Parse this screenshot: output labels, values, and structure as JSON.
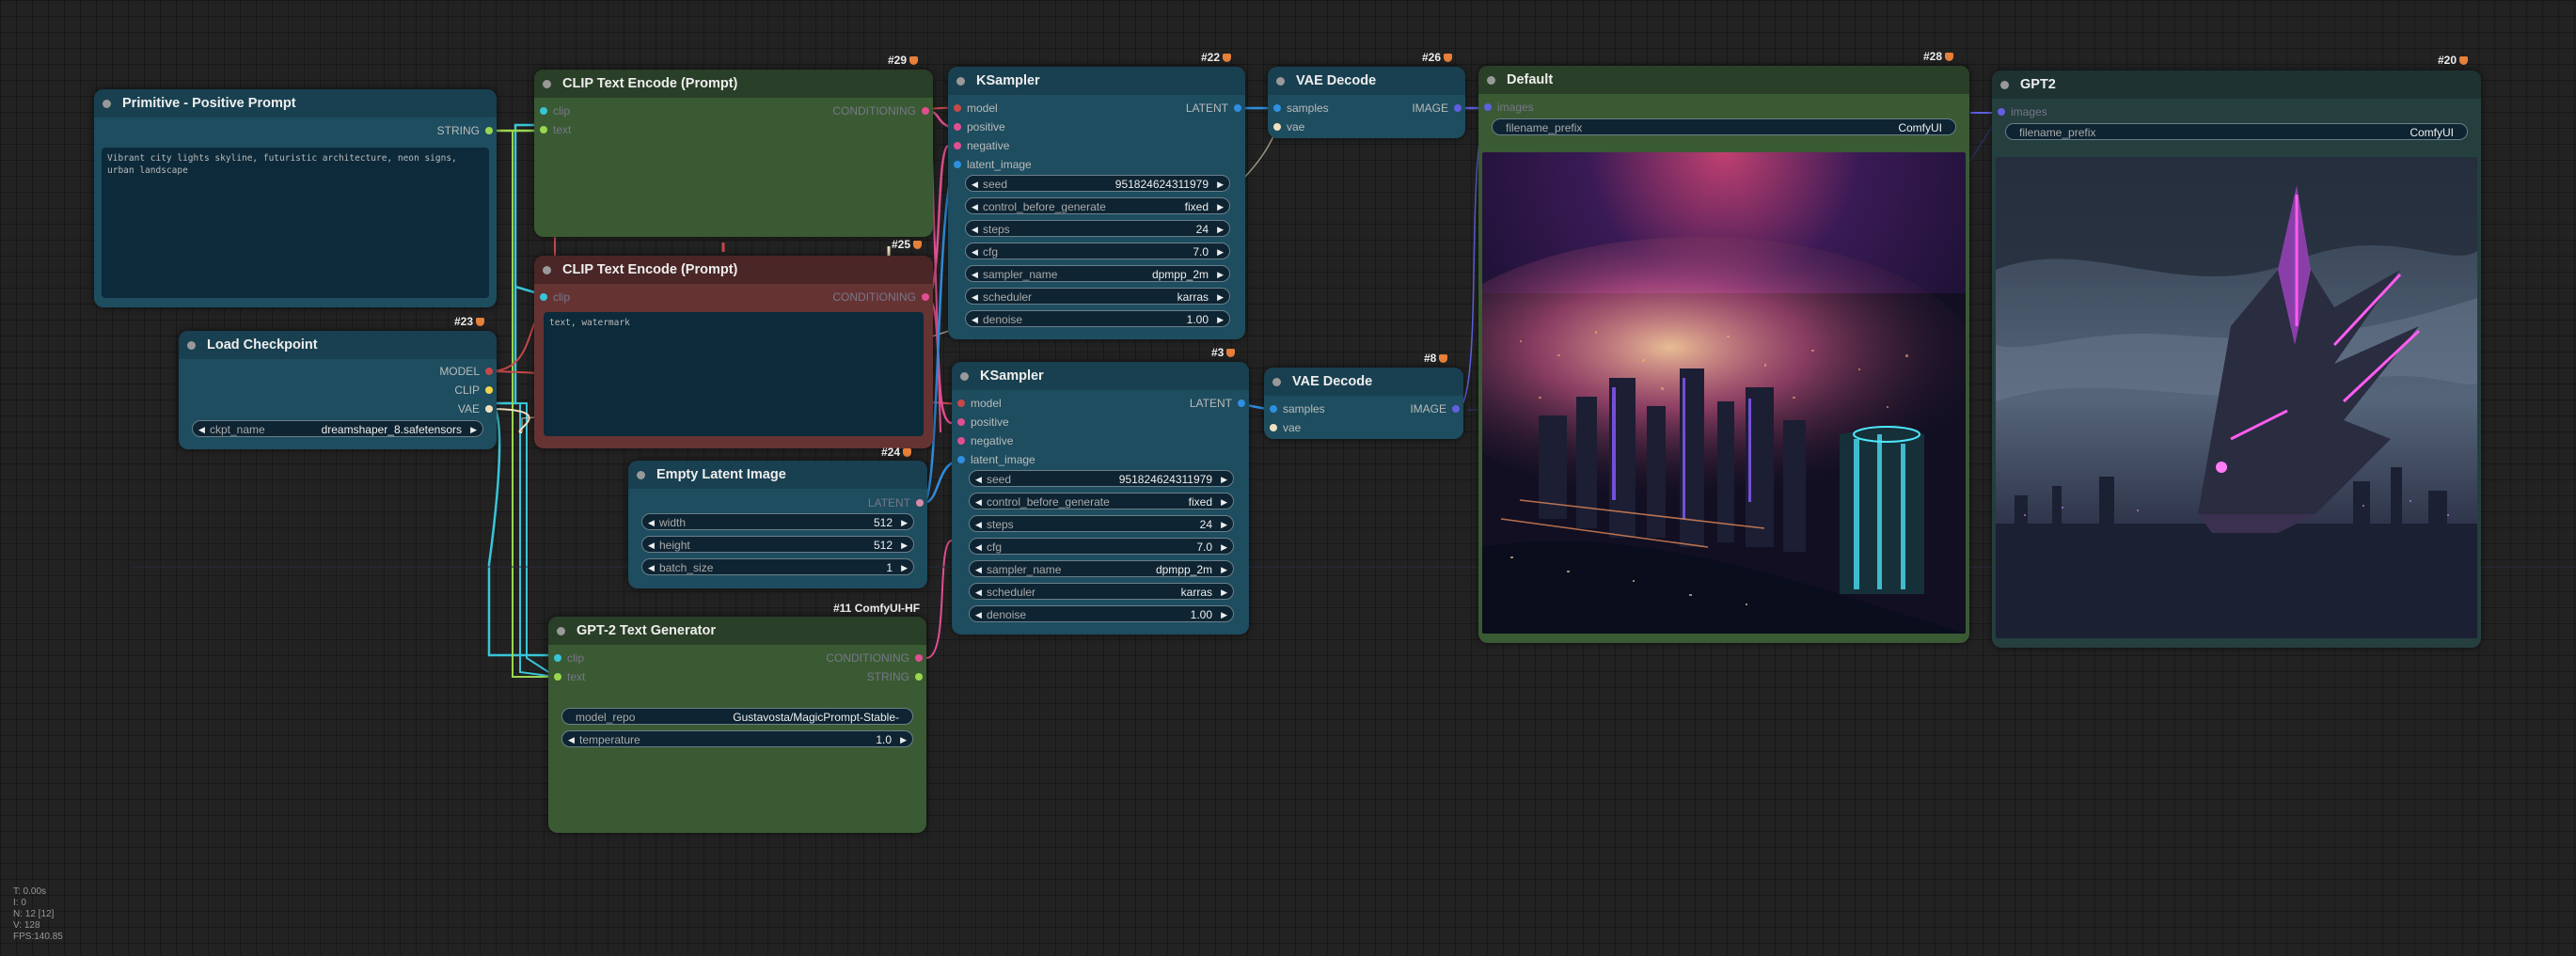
{
  "colors": {
    "canvas_bg": "#222222",
    "clip_wire": "#39c5d8",
    "string_wire": "#9ad650",
    "conditioning_wire": "#e05090",
    "latent_wire": "#d98aa8",
    "model_wire": "#c74848",
    "vae_wire": "#f0e0c0",
    "image_wire": "#6060e0",
    "node_blue": "#1d4d5f",
    "node_green": "#3a5a33",
    "node_red": "#663333"
  },
  "nodes": {
    "primitive": {
      "title": "Primitive - Positive Prompt",
      "output": "STRING",
      "text": "Vibrant city lights skyline, futuristic architecture, neon signs, urban landscape"
    },
    "clip_pos": {
      "badge": "#29",
      "title": "CLIP Text Encode (Prompt)",
      "inputs": [
        "clip",
        "text"
      ],
      "output": "CONDITIONING"
    },
    "clip_neg": {
      "badge": "#25",
      "title": "CLIP Text Encode (Prompt)",
      "inputs": [
        "clip"
      ],
      "output": "CONDITIONING",
      "text": "text, watermark"
    },
    "checkpoint": {
      "badge": "#23",
      "title": "Load Checkpoint",
      "outputs": [
        "MODEL",
        "CLIP",
        "VAE"
      ],
      "ckpt_label": "ckpt_name",
      "ckpt_value": "dreamshaper_8.safetensors"
    },
    "latent": {
      "badge": "#24",
      "title": "Empty Latent Image",
      "output": "LATENT",
      "widgets": [
        {
          "label": "width",
          "value": "512"
        },
        {
          "label": "height",
          "value": "512"
        },
        {
          "label": "batch_size",
          "value": "1"
        }
      ]
    },
    "gpt2gen": {
      "badge": "#11 ComfyUI-HF",
      "title": "GPT-2 Text Generator",
      "inputs": [
        "clip",
        "text"
      ],
      "outputs": [
        "CONDITIONING",
        "STRING"
      ],
      "widgets": [
        {
          "label": "model_repo",
          "value": "Gustavosta/MagicPrompt-Stable-"
        },
        {
          "label": "temperature",
          "value": "1.0"
        }
      ]
    },
    "ksampler1": {
      "badge": "#22",
      "title": "KSampler",
      "inputs": [
        "model",
        "positive",
        "negative",
        "latent_image"
      ],
      "output": "LATENT",
      "widgets": [
        {
          "label": "seed",
          "value": "951824624311979"
        },
        {
          "label": "control_before_generate",
          "value": "fixed"
        },
        {
          "label": "steps",
          "value": "24"
        },
        {
          "label": "cfg",
          "value": "7.0"
        },
        {
          "label": "sampler_name",
          "value": "dpmpp_2m"
        },
        {
          "label": "scheduler",
          "value": "karras"
        },
        {
          "label": "denoise",
          "value": "1.00"
        }
      ]
    },
    "ksampler2": {
      "badge": "#3",
      "title": "KSampler",
      "inputs": [
        "model",
        "positive",
        "negative",
        "latent_image"
      ],
      "output": "LATENT",
      "widgets": [
        {
          "label": "seed",
          "value": "951824624311979"
        },
        {
          "label": "control_before_generate",
          "value": "fixed"
        },
        {
          "label": "steps",
          "value": "24"
        },
        {
          "label": "cfg",
          "value": "7.0"
        },
        {
          "label": "sampler_name",
          "value": "dpmpp_2m"
        },
        {
          "label": "scheduler",
          "value": "karras"
        },
        {
          "label": "denoise",
          "value": "1.00"
        }
      ]
    },
    "vae1": {
      "badge": "#26",
      "title": "VAE Decode",
      "inputs": [
        "samples",
        "vae"
      ],
      "output": "IMAGE"
    },
    "vae2": {
      "badge": "#8",
      "title": "VAE Decode",
      "inputs": [
        "samples",
        "vae"
      ],
      "output": "IMAGE"
    },
    "save_default": {
      "badge": "#28",
      "title": "Default",
      "input": "images",
      "prefix_label": "filename_prefix",
      "prefix_value": "ComfyUI"
    },
    "save_gpt2": {
      "badge": "#20",
      "title": "GPT2",
      "input": "images",
      "prefix_label": "filename_prefix",
      "prefix_value": "ComfyUI"
    }
  },
  "stats": [
    "T: 0.00s",
    "I: 0",
    "N: 12 [12]",
    "V: 128",
    "FPS:140.85"
  ]
}
